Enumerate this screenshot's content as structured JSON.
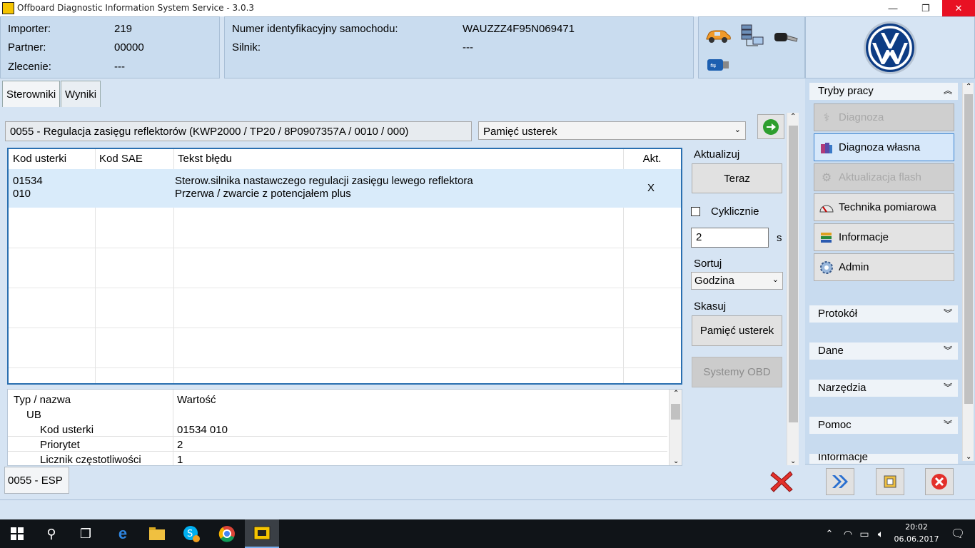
{
  "window": {
    "title": "Offboard Diagnostic Information System Service - 3.0.3",
    "minimize": "—",
    "maximize": "❐",
    "close": "✕"
  },
  "header": {
    "importer_label": "Importer:",
    "importer_value": "219",
    "partner_label": "Partner:",
    "partner_value": "00000",
    "order_label": "Zlecenie:",
    "order_value": "---",
    "vin_label": "Numer identyfikacyjny samochodu:",
    "vin_value": "WAUZZZ4F95N069471",
    "engine_label": "Silnik:",
    "engine_value": "---"
  },
  "tabs": [
    {
      "label": "Sterowniki"
    },
    {
      "label": "Wyniki"
    }
  ],
  "control_unit": "0055 - Regulacja zasięgu reflektorów  (KWP2000 / TP20 / 8P0907357A   / 0010 / 000)",
  "memory_select": "Pamięć usterek",
  "fault_table": {
    "headers": [
      "Kod usterki",
      "Kod SAE",
      "Tekst błędu",
      "Akt."
    ],
    "rows": [
      {
        "code_line1": "01534",
        "code_line2": "010",
        "sae": "",
        "text_line1": "Sterow.silnika nastawczego regulacji zasięgu lewego reflektora",
        "text_line2": "Przerwa / zwarcie z potencjałem plus",
        "active": "X"
      }
    ]
  },
  "update": {
    "label": "Aktualizuj",
    "now_button": "Teraz",
    "cyclic_label": "Cyklicznie",
    "interval_value": "2",
    "unit": "s"
  },
  "sort": {
    "label": "Sortuj",
    "value": "Godzina"
  },
  "delete": {
    "label": "Skasuj",
    "memory_button": "Pamięć usterek",
    "obd_button": "Systemy OBD"
  },
  "details": {
    "headers": [
      "Typ / nazwa",
      "Wartość"
    ],
    "group": "UB",
    "rows": [
      {
        "name": "Kod usterki",
        "value": "01534 010"
      },
      {
        "name": "Priorytet",
        "value": "2"
      },
      {
        "name": "Licznik częstotliwości",
        "value": "1"
      }
    ]
  },
  "bottom_tab": "0055 - ESP",
  "sidebar": {
    "modes_title": "Tryby pracy",
    "modes": [
      {
        "label": "Diagnoza",
        "icon": "stethoscope-icon",
        "state": "disabled"
      },
      {
        "label": "Diagnoza własna",
        "icon": "books-icon",
        "state": "selected"
      },
      {
        "label": "Aktualizacja flash",
        "icon": "flash-icon",
        "state": "disabled"
      },
      {
        "label": "Technika pomiarowa",
        "icon": "gauge-icon",
        "state": "normal"
      },
      {
        "label": "Informacje",
        "icon": "info-books-icon",
        "state": "normal"
      },
      {
        "label": "Admin",
        "icon": "admin-gear-icon",
        "state": "normal"
      }
    ],
    "sections": [
      "Protokół",
      "Dane",
      "Narzędzia",
      "Pomoc",
      "Informacje"
    ]
  },
  "taskbar": {
    "time": "20:02",
    "date": "06.06.2017"
  },
  "colors": {
    "accent": "#2a6fb0",
    "selected_row": "#d9ebfa",
    "brand_blue": "#0f3c7a",
    "close_red": "#e81123"
  }
}
